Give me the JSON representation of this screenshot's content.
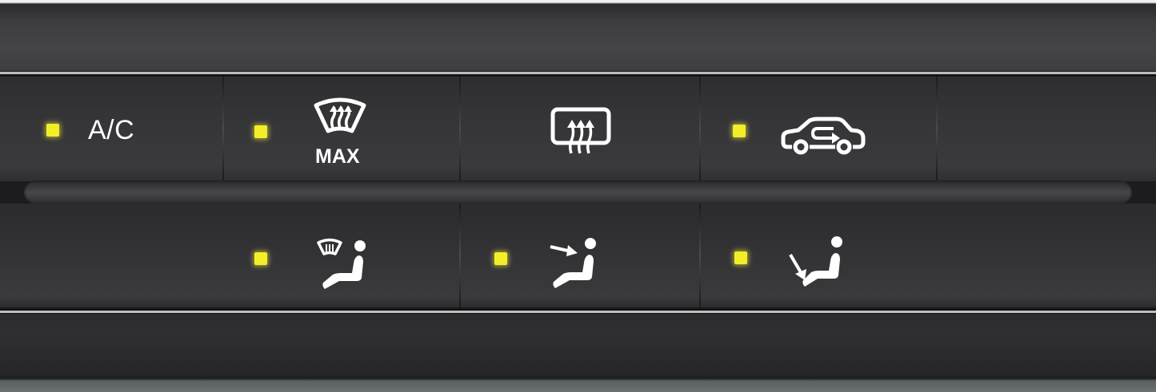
{
  "climate_panel": {
    "top_row": [
      {
        "id": "ac",
        "label": "A/C",
        "led": "on"
      },
      {
        "id": "max_defrost",
        "label": "MAX",
        "icon": "windshield-defrost-icon",
        "led": "on"
      },
      {
        "id": "rear_defrost",
        "icon": "rear-window-defrost-icon",
        "led": "none"
      },
      {
        "id": "recirculation",
        "icon": "air-recirculation-icon",
        "led": "on"
      },
      {
        "id": "blank",
        "led": "none"
      }
    ],
    "bottom_row": [
      {
        "id": "floor_defrost_mode",
        "icon": "defrost-floor-mode-icon",
        "led": "on"
      },
      {
        "id": "face_mode",
        "icon": "face-vent-mode-icon",
        "led": "on"
      },
      {
        "id": "floor_mode",
        "icon": "floor-vent-mode-icon",
        "led": "on"
      }
    ],
    "colors": {
      "led": "#f3ee28",
      "icon": "#ffffff",
      "panel": "#2e2e30",
      "bezel": "#bdbdbd"
    }
  }
}
